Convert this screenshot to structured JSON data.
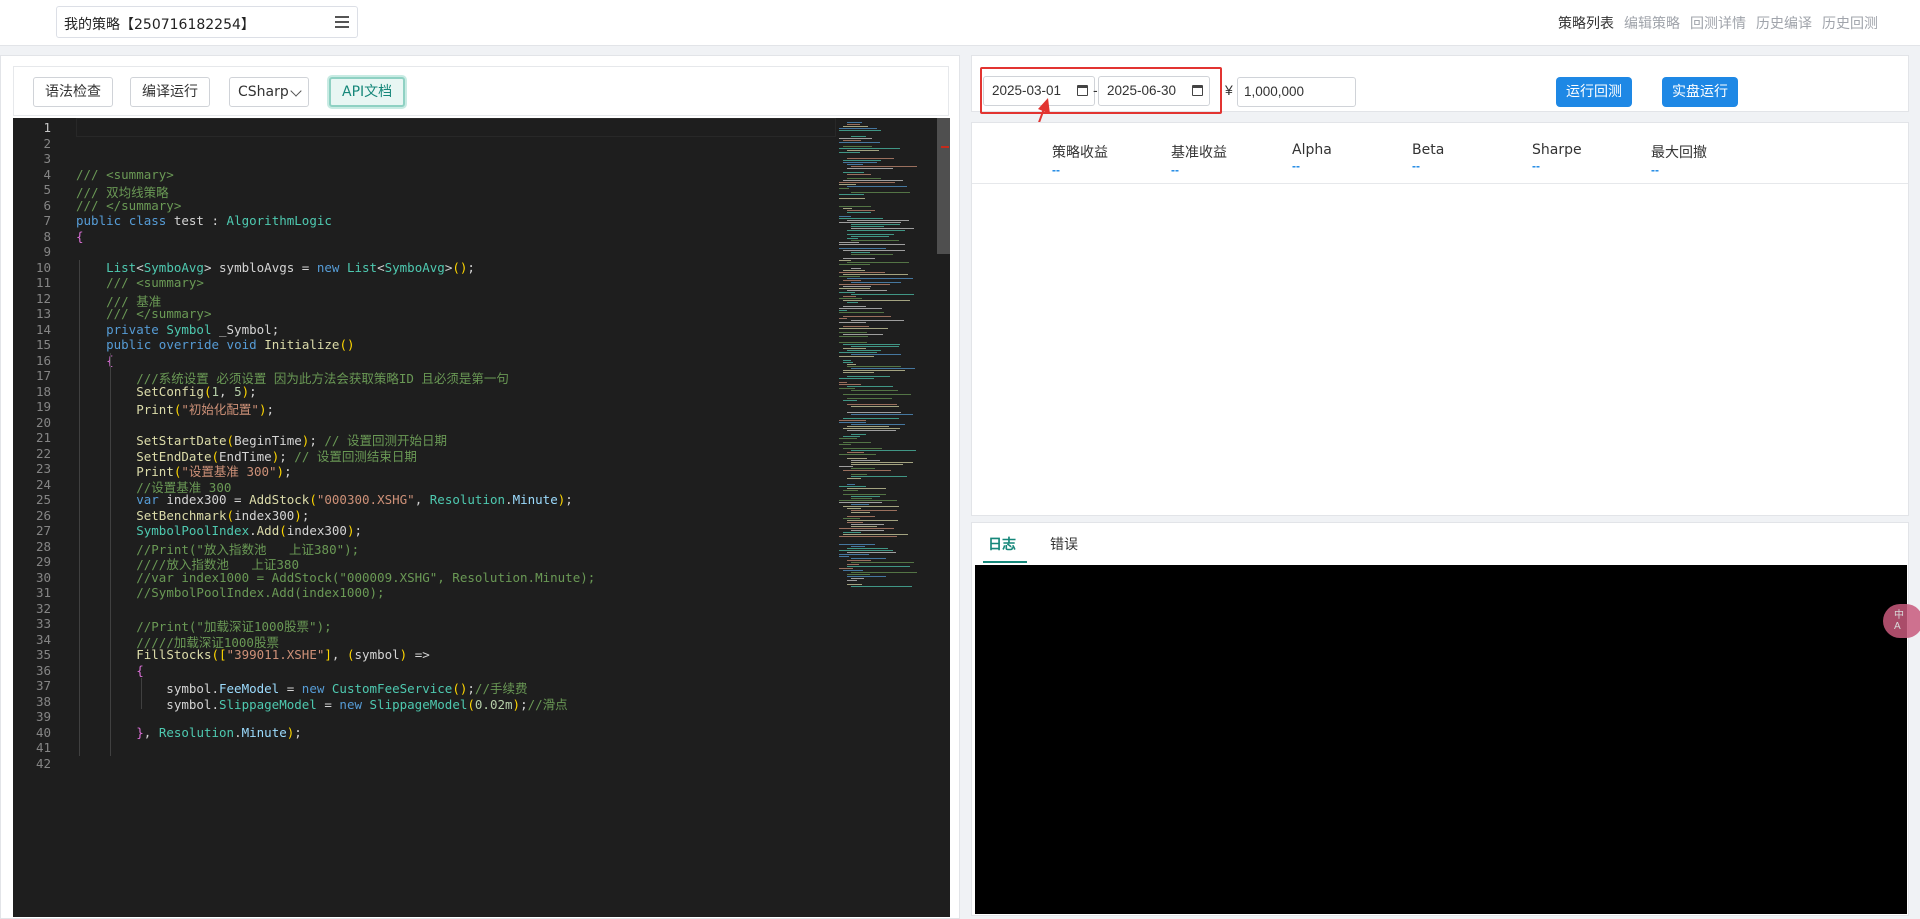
{
  "header": {
    "strategy_name": "我的策略【250716182254】",
    "nav": [
      {
        "label": "策略列表",
        "active": true
      },
      {
        "label": "编辑策略",
        "active": false
      },
      {
        "label": "回测详情",
        "active": false
      },
      {
        "label": "历史编译",
        "active": false
      },
      {
        "label": "历史回测",
        "active": false
      }
    ]
  },
  "toolbar": {
    "lint_label": "语法检查",
    "compile_label": "编译运行",
    "language": "CSharp",
    "api_label": "API文档"
  },
  "editor": {
    "current_line": 1,
    "lines": [
      "",
      "",
      "",
      "/// <summary>",
      "/// 双均线策略",
      "/// </summary>",
      "public class test : AlgorithmLogic",
      "{",
      "",
      "    List<SymboAvg> symbloAvgs = new List<SymboAvg>();",
      "    /// <summary>",
      "    /// 基准",
      "    /// </summary>",
      "    private Symbol _Symbol;",
      "    public override void Initialize()",
      "    {",
      "        ///系统设置 必须设置 因为此方法会获取策略ID 且必须是第一句",
      "        SetConfig(1, 5);",
      "        Print(\"初始化配置\");",
      "",
      "        SetStartDate(BeginTime); // 设置回测开始日期",
      "        SetEndDate(EndTime); // 设置回测结束日期",
      "        Print(\"设置基准 300\");",
      "        //设置基准 300",
      "        var index300 = AddStock(\"000300.XSHG\", Resolution.Minute);",
      "        SetBenchmark(index300);",
      "        SymbolPoolIndex.Add(index300);",
      "        //Print(\"放入指数池   上证380\");",
      "        ////放入指数池   上证380",
      "        //var index1000 = AddStock(\"000009.XSHG\", Resolution.Minute);",
      "        //SymbolPoolIndex.Add(index1000);",
      "",
      "        //Print(\"加载深证1000股票\");",
      "        /////加载深证1000股票",
      "        FillStocks([\"399011.XSHE\"], (symbol) =>",
      "        {",
      "            symbol.FeeModel = new CustomFeeService();//手续费",
      "            symbol.SlippageModel = new SlippageModel(0.02m);//滑点",
      "",
      "        }, Resolution.Minute);",
      "",
      ""
    ]
  },
  "backtest": {
    "start_date": "2025-03-01",
    "end_date": "2025-06-30",
    "date_separator": "-",
    "currency_symbol": "¥",
    "capital": "1,000,000",
    "run_backtest_label": "运行回测",
    "live_run_label": "实盘运行"
  },
  "stats": [
    {
      "label": "策略收益",
      "value": "--"
    },
    {
      "label": "基准收益",
      "value": "--"
    },
    {
      "label": "Alpha",
      "value": "--"
    },
    {
      "label": "Beta",
      "value": "--"
    },
    {
      "label": "Sharpe",
      "value": "--"
    },
    {
      "label": "最大回撤",
      "value": "--"
    }
  ],
  "log_tabs": [
    {
      "label": "日志",
      "active": true
    },
    {
      "label": "错误",
      "active": false
    }
  ],
  "float_badge": {
    "line1": "中",
    "line2": "A"
  },
  "colors": {
    "accent_teal": "#16877a",
    "primary_blue": "#1e88e5",
    "highlight_red": "#e23431",
    "editor_bg": "#1e1e1e",
    "console_bg": "#000000"
  }
}
